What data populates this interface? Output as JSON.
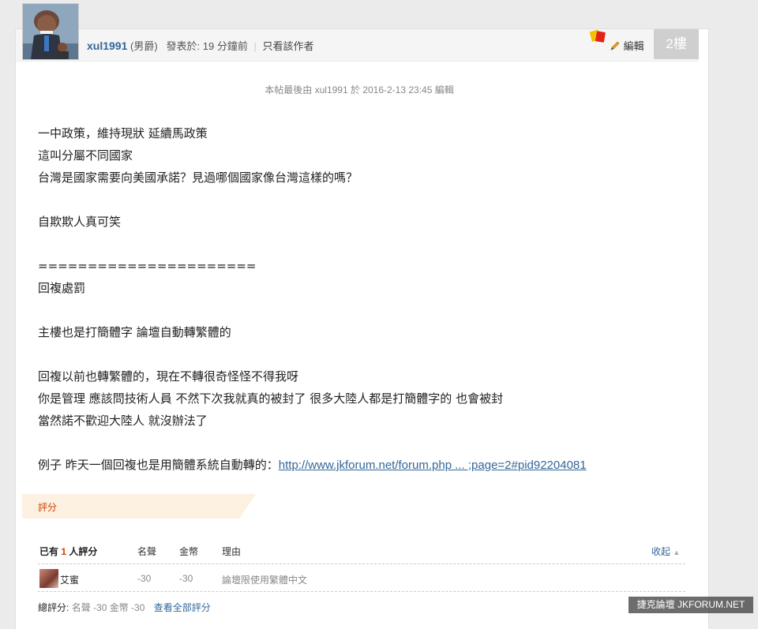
{
  "header": {
    "username": "xul1991",
    "gender": "(男爵)",
    "posted_label": "發表於:",
    "posted_time": "19 分鐘前",
    "only_author": "只看該作者",
    "edit_label": "編輯",
    "floor": "2樓"
  },
  "edited_note": "本帖最後由 xul1991 於 2016-2-13 23:45 編輯",
  "content": {
    "line1": "一中政策，維持現狀 延續馬政策",
    "line2": "這叫分屬不同國家",
    "line3": "台灣是國家需要向美國承諾？見過哪個國家像台灣這樣的嗎？",
    "line4": "自欺欺人真可笑",
    "line5": "======================",
    "line6": "回複處罰",
    "line7": "主樓也是打簡體字 論壇自動轉繁體的",
    "line8": "回複以前也轉繁體的，現在不轉很奇怪怪不得我呀",
    "line9": "你是管理 應該問技術人員 不然下次我就真的被封了 很多大陸人都是打簡體字的 也會被封",
    "line10": "當然諾不歡迎大陸人 就沒辦法了",
    "line11_prefix": "例子 昨天一個回複也是用簡體系統自動轉的：",
    "line11_link": "http://www.jkforum.net/forum.php ... ;page=2#pid92204081"
  },
  "rating": {
    "tab_label": "評分",
    "count_prefix": "已有",
    "count_num": "1",
    "count_suffix": "人評分",
    "col_fame": "名聲",
    "col_gold": "金幣",
    "col_reason": "理由",
    "collapse": "收起",
    "rows": [
      {
        "name": "艾蜜",
        "fame": "-30",
        "gold": "-30",
        "reason": "論壇限使用繁體中文"
      }
    ],
    "total_label": "總評分:",
    "total_values": "名聲 -30 金幣 -30",
    "view_all": "查看全部評分"
  },
  "watermark": "捷克論壇 JKFORUM.NET",
  "colors": {
    "link": "#336699",
    "accent": "#d04000",
    "floor_bg": "#cfcfcf"
  }
}
